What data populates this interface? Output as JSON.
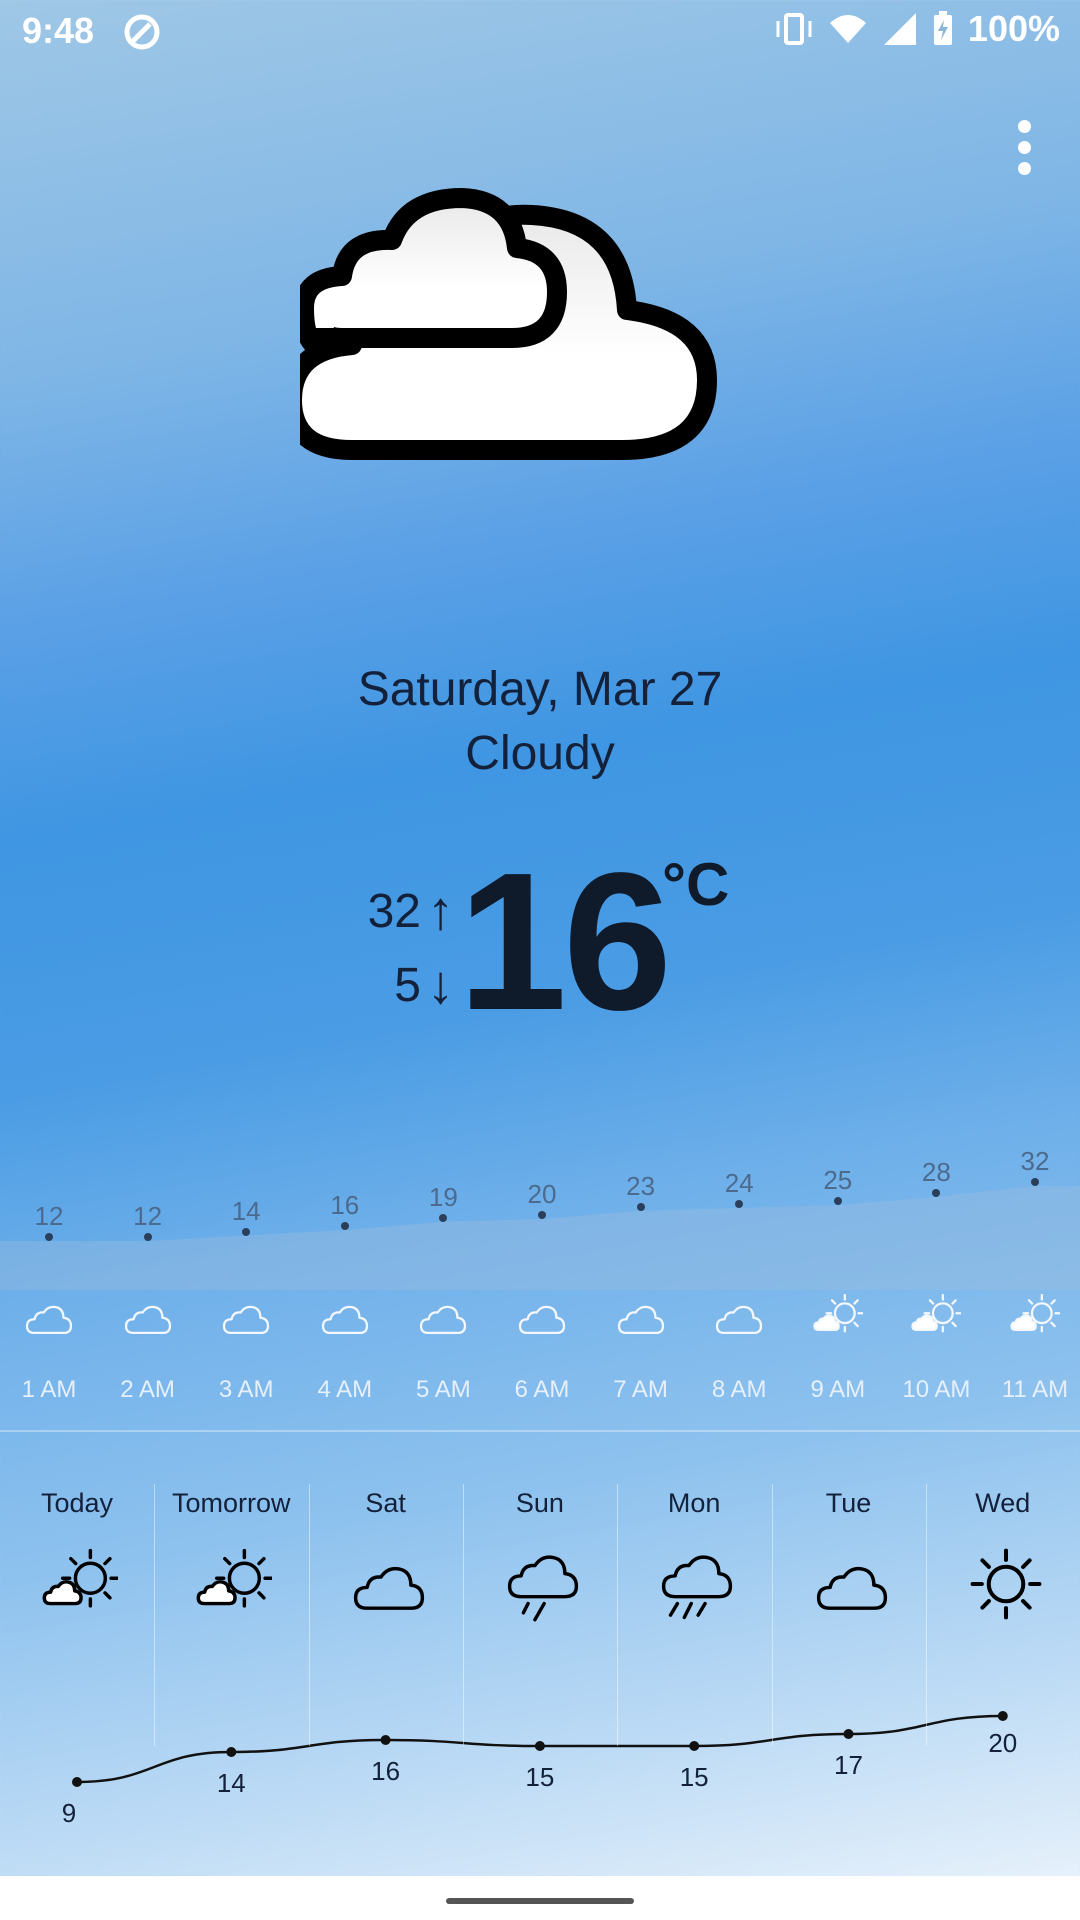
{
  "status_bar": {
    "time": "9:48",
    "battery": "100%"
  },
  "current": {
    "date": "Saturday, Mar 27",
    "condition": "Cloudy",
    "temperature": "16",
    "unit": "°C",
    "high": "32",
    "low": "5",
    "icon": "cloudy-icon"
  },
  "hourly": [
    {
      "time": "1 AM",
      "temp": "12",
      "icon": "cloud-icon"
    },
    {
      "time": "2 AM",
      "temp": "12",
      "icon": "cloud-icon"
    },
    {
      "time": "3 AM",
      "temp": "14",
      "icon": "cloud-icon"
    },
    {
      "time": "4 AM",
      "temp": "16",
      "icon": "cloud-icon"
    },
    {
      "time": "5 AM",
      "temp": "19",
      "icon": "cloud-icon"
    },
    {
      "time": "6 AM",
      "temp": "20",
      "icon": "cloud-icon"
    },
    {
      "time": "7 AM",
      "temp": "23",
      "icon": "cloud-icon"
    },
    {
      "time": "8 AM",
      "temp": "24",
      "icon": "cloud-icon"
    },
    {
      "time": "9 AM",
      "temp": "25",
      "icon": "partly-sunny-icon"
    },
    {
      "time": "10 AM",
      "temp": "28",
      "icon": "partly-sunny-icon"
    },
    {
      "time": "11 AM",
      "temp": "32",
      "icon": "partly-sunny-icon"
    }
  ],
  "daily": [
    {
      "day": "Today",
      "temp": "9",
      "icon": "partly-sunny-icon"
    },
    {
      "day": "Tomorrow",
      "temp": "14",
      "icon": "partly-sunny-icon"
    },
    {
      "day": "Sat",
      "temp": "16",
      "icon": "cloud-icon"
    },
    {
      "day": "Sun",
      "temp": "15",
      "icon": "rain-icon"
    },
    {
      "day": "Mon",
      "temp": "15",
      "icon": "heavy-rain-icon"
    },
    {
      "day": "Tue",
      "temp": "17",
      "icon": "cloud-icon"
    },
    {
      "day": "Wed",
      "temp": "20",
      "icon": "sun-icon"
    }
  ]
}
